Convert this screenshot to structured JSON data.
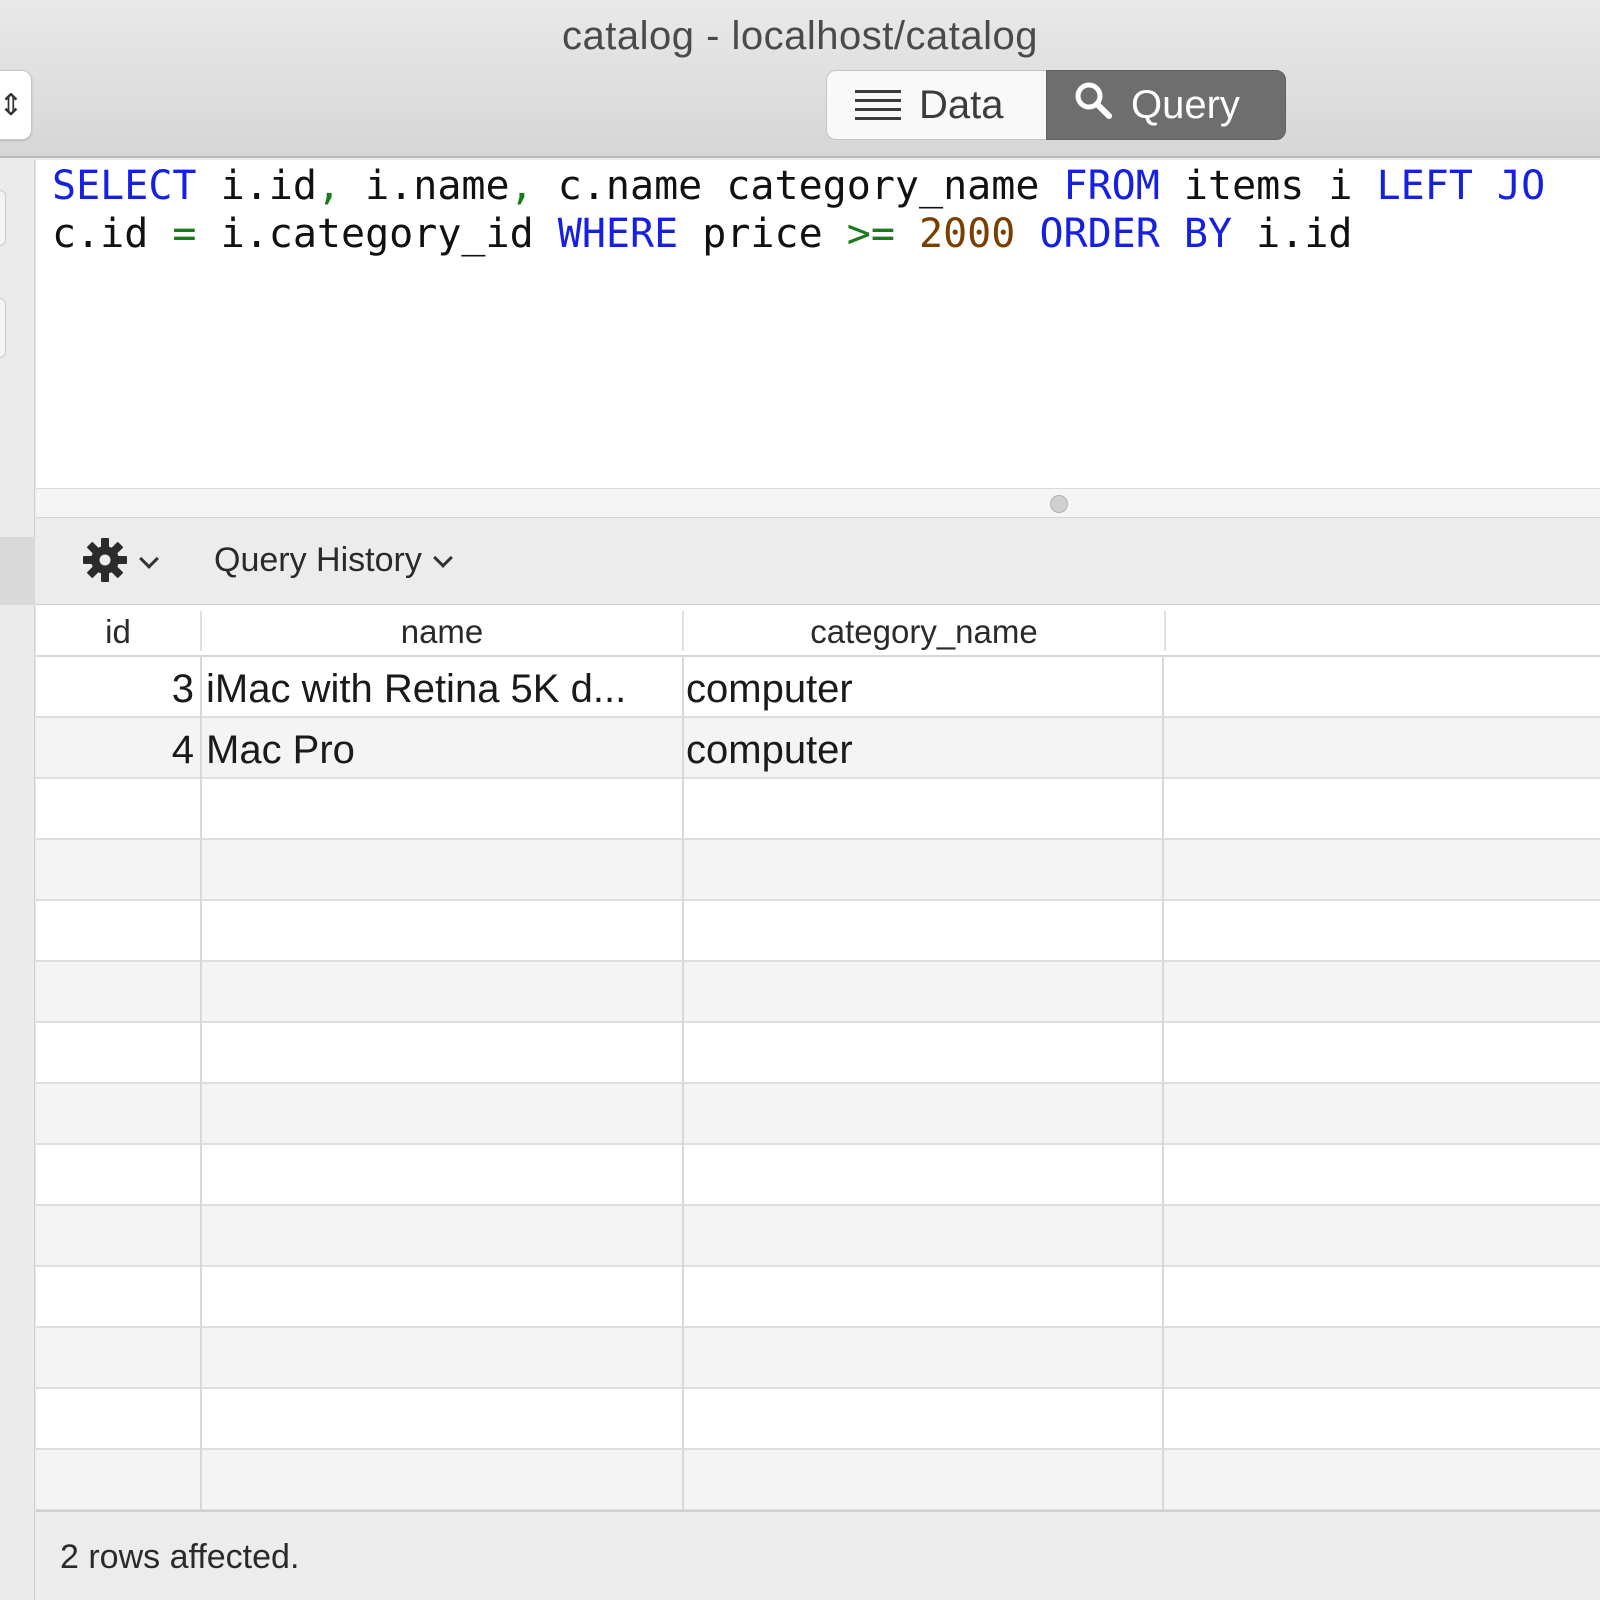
{
  "window": {
    "title": "catalog - localhost/catalog"
  },
  "toolbar": {
    "data_label": "Data",
    "query_label": "Query",
    "active": "Query"
  },
  "editor": {
    "line1": [
      {
        "t": "SELECT",
        "k": "kw"
      },
      {
        "t": " i.id",
        "k": ""
      },
      {
        "t": ",",
        "k": "punc"
      },
      {
        "t": " i.name",
        "k": ""
      },
      {
        "t": ",",
        "k": "punc"
      },
      {
        "t": " c.name category_name ",
        "k": ""
      },
      {
        "t": "FROM",
        "k": "kw"
      },
      {
        "t": " items i ",
        "k": ""
      },
      {
        "t": "LEFT JO",
        "k": "kw"
      }
    ],
    "line2": [
      {
        "t": "c.id ",
        "k": ""
      },
      {
        "t": "=",
        "k": "punc"
      },
      {
        "t": " i.category_id ",
        "k": ""
      },
      {
        "t": "WHERE",
        "k": "kw"
      },
      {
        "t": " price ",
        "k": ""
      },
      {
        "t": ">=",
        "k": "punc"
      },
      {
        "t": " ",
        "k": ""
      },
      {
        "t": "2000",
        "k": "num"
      },
      {
        "t": " ",
        "k": ""
      },
      {
        "t": "ORDER BY",
        "k": "kw"
      },
      {
        "t": " i.id",
        "k": ""
      }
    ]
  },
  "query_bar": {
    "gear_icon": "gear-icon",
    "history_label": "Query History"
  },
  "results": {
    "columns": [
      "id",
      "name",
      "category_name"
    ],
    "rows": [
      {
        "id": "3",
        "name": "iMac with Retina 5K d...",
        "category_name": "computer"
      },
      {
        "id": "4",
        "name": "Mac Pro",
        "category_name": "computer"
      }
    ]
  },
  "status": {
    "text": "2 rows affected."
  }
}
